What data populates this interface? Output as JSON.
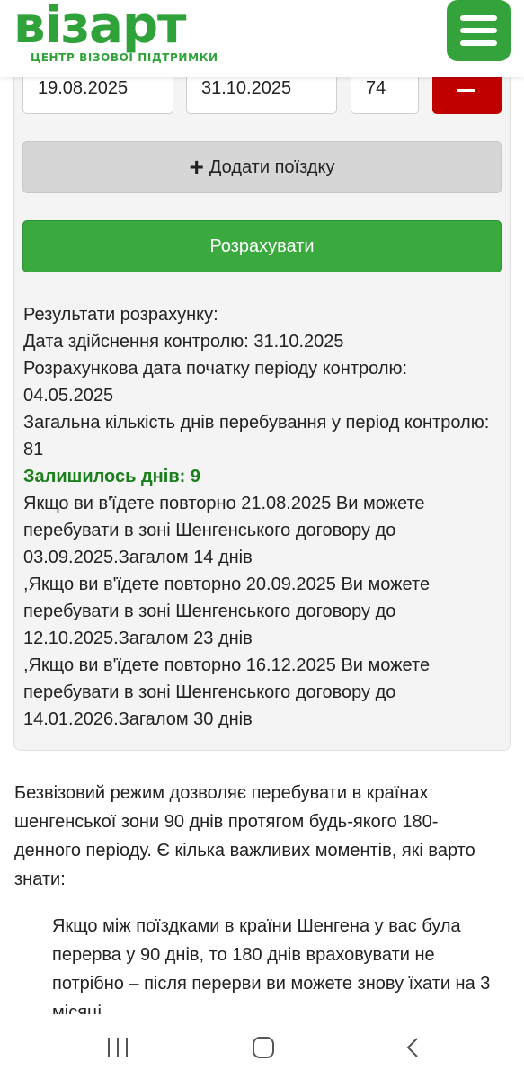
{
  "header": {
    "logo_text": "візарт",
    "logo_subtitle": "ЦЕНТР ВІЗОВОЇ ПІДТРИМКИ",
    "menu_icon": "hamburger-menu-icon",
    "brand_color": "#35a33b"
  },
  "trip_row": {
    "entry_date": "19.08.2025",
    "exit_date": "31.10.2025",
    "days": "74",
    "remove_icon": "minus-icon",
    "remove_color": "#c00000"
  },
  "actions": {
    "add_trip_icon": "plus-icon",
    "add_trip_label": "Додати поїздку",
    "calculate_label": "Розрахувати"
  },
  "results": {
    "heading": "Результати розрахунку:",
    "control_date": "Дата здійснення контролю: 31.10.2025",
    "period_start": "Розрахункова дата початку періоду контролю: 04.05.2025",
    "total_days": "Загальна кількість днів перебування у період контролю: 81",
    "remaining": "Залишилось днів: 9",
    "reentry_1": "Якщо ви в'їдете повторно 21.08.2025 Ви можете перебувати в зоні Шенгенського договору до 03.09.2025.Загалом 14 днів",
    "reentry_2": ",Якщо ви в'їдете повторно 20.09.2025 Ви можете перебувати в зоні Шенгенського договору до 12.10.2025.Загалом 23 днів",
    "reentry_3": ",Якщо ви в'їдете повторно 16.12.2025 Ви можете перебувати в зоні Шенгенського договору до 14.01.2026.Загалом 30 днів"
  },
  "article": {
    "intro": "Безвізовий режим дозволяє перебувати в країнах шенгенської зони 90 днів протягом будь-якого 180-денного періоду. Є кілька важливих моментів, які варто знати:",
    "bullet_1": "Якщо між поїздками в країни Шенгена у вас була перерва у 90 днів, то 180 днів враховувати не потрібно – після перерви ви можете знову їхати на 3 місяці"
  },
  "navbar": {
    "recent_icon": "recent-apps-icon",
    "home_icon": "home-icon",
    "back_icon": "back-icon"
  }
}
